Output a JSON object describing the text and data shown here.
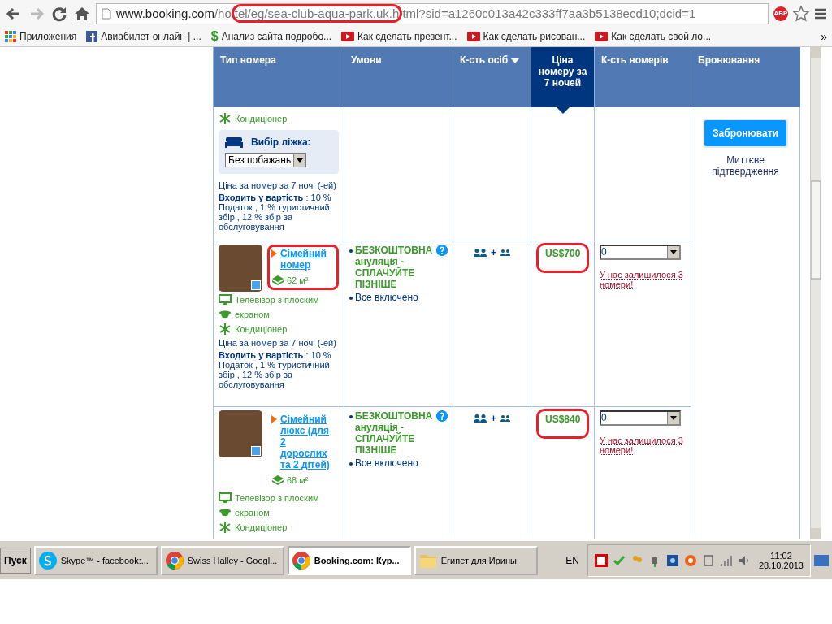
{
  "address_bar": {
    "host": "www.booking.com",
    "path_start": "/ho",
    "path_circled": "tel/eg/sea-club-aqua-park.uk.h",
    "path_end": "tml?sid=a1260c013a42c333ff7aa3b5138ecd10;dcid=1",
    "circled": true
  },
  "adblock_badge": "ABP",
  "bookmarks": [
    {
      "kind": "apps",
      "label": "Приложения"
    },
    {
      "kind": "facebook",
      "label": "Авиабилет онлайн | ..."
    },
    {
      "kind": "dollar",
      "glyph": "$",
      "label": "Анализ сайта подробо..."
    },
    {
      "kind": "video",
      "label": "Как сделать презент..."
    },
    {
      "kind": "video",
      "label": "Как сделать рисован..."
    },
    {
      "kind": "video",
      "label": "Как сделать свой ло..."
    }
  ],
  "bookmarks_more": "»",
  "table": {
    "columns": [
      {
        "label": "Тип номера",
        "selected": false,
        "dropdown": false
      },
      {
        "label": "Умови",
        "selected": false,
        "dropdown": false
      },
      {
        "label": "К-сть осіб",
        "selected": false,
        "dropdown": true
      },
      {
        "label": "Ціна номеру за 7 ночей",
        "selected": true,
        "dropdown": false
      },
      {
        "label": "К-сть номерів",
        "selected": false,
        "dropdown": false
      },
      {
        "label": "Бронювання",
        "selected": false,
        "dropdown": false
      }
    ],
    "rows": [
      {
        "amenities": [
          {
            "kind": "snowflake",
            "text": "Кондиціонер"
          }
        ],
        "bed_choice": {
          "label": "Вибір ліжка:",
          "value": "Без побажань"
        },
        "price_note": "Ціна за номер за 7 ночі (-ей)",
        "included": "**Входить у вартість** : 10 % Податок , 1 % туристичний збір , 12 % збір за обслуговування"
      },
      {
        "title": "Сімейний номер",
        "area": "62 м²",
        "circled": true,
        "amenities": [
          {
            "kind": "tv",
            "text": "Телевізор з плоским"
          },
          {
            "kind": "dish",
            "text": "екраном"
          },
          {
            "kind": "snowflake",
            "text": "Кондиціонер"
          }
        ],
        "price_note": "Ціна за номер за 7 ночі (-ей)",
        "included": "**Входить у вартість** : 10 % Податок , 1 % туристичний збір , 12 % збір за обслуговування",
        "conditions": [
          {
            "kind": "cancellation",
            "text": "БЕЗКОШТОВНА ануляція - СПЛАЧУЙТЕ ПІЗНІШЕ"
          },
          {
            "kind": "plain",
            "text": "Все включено"
          }
        ],
        "occupancy_plus": "+",
        "price": "US$700",
        "price_circled": true,
        "quantity": "0",
        "availability": "У нас залишилося 3 номери!"
      },
      {
        "title": "Сімейний люкс (для 2 дорослих та 2 дітей)",
        "area": "68 м²",
        "circled": false,
        "amenities": [
          {
            "kind": "tv",
            "text": "Телевізор з плоским"
          },
          {
            "kind": "dish",
            "text": "екраном"
          },
          {
            "kind": "snowflake",
            "text": "Кондиціонер"
          }
        ],
        "conditions": [
          {
            "kind": "cancellation",
            "text": "БЕЗКОШТОВНА ануляція - СПЛАЧУЙТЕ ПІЗНІШЕ"
          },
          {
            "kind": "plain",
            "text": "Все включено"
          }
        ],
        "occupancy_plus": "+",
        "price": "US$840",
        "price_circled": true,
        "quantity": "0",
        "availability": "У нас залишилося 3 номери!"
      }
    ],
    "booking": {
      "button": "Забронювати",
      "note": "Миттєве підтвердження"
    }
  },
  "taskbar": {
    "start": "Пуск",
    "tasks": [
      {
        "kind": "skype",
        "label": "Skype™ - facebook:...",
        "selected": false
      },
      {
        "kind": "chrome",
        "label": "Swiss Halley - Googl...",
        "selected": false
      },
      {
        "kind": "chrome",
        "label": "Booking.com: Кур...",
        "selected": true
      },
      {
        "kind": "folder",
        "label": "Египет для Ирины",
        "selected": false
      }
    ],
    "language": "EN",
    "time": "11:02",
    "date": "28.10.2013"
  }
}
